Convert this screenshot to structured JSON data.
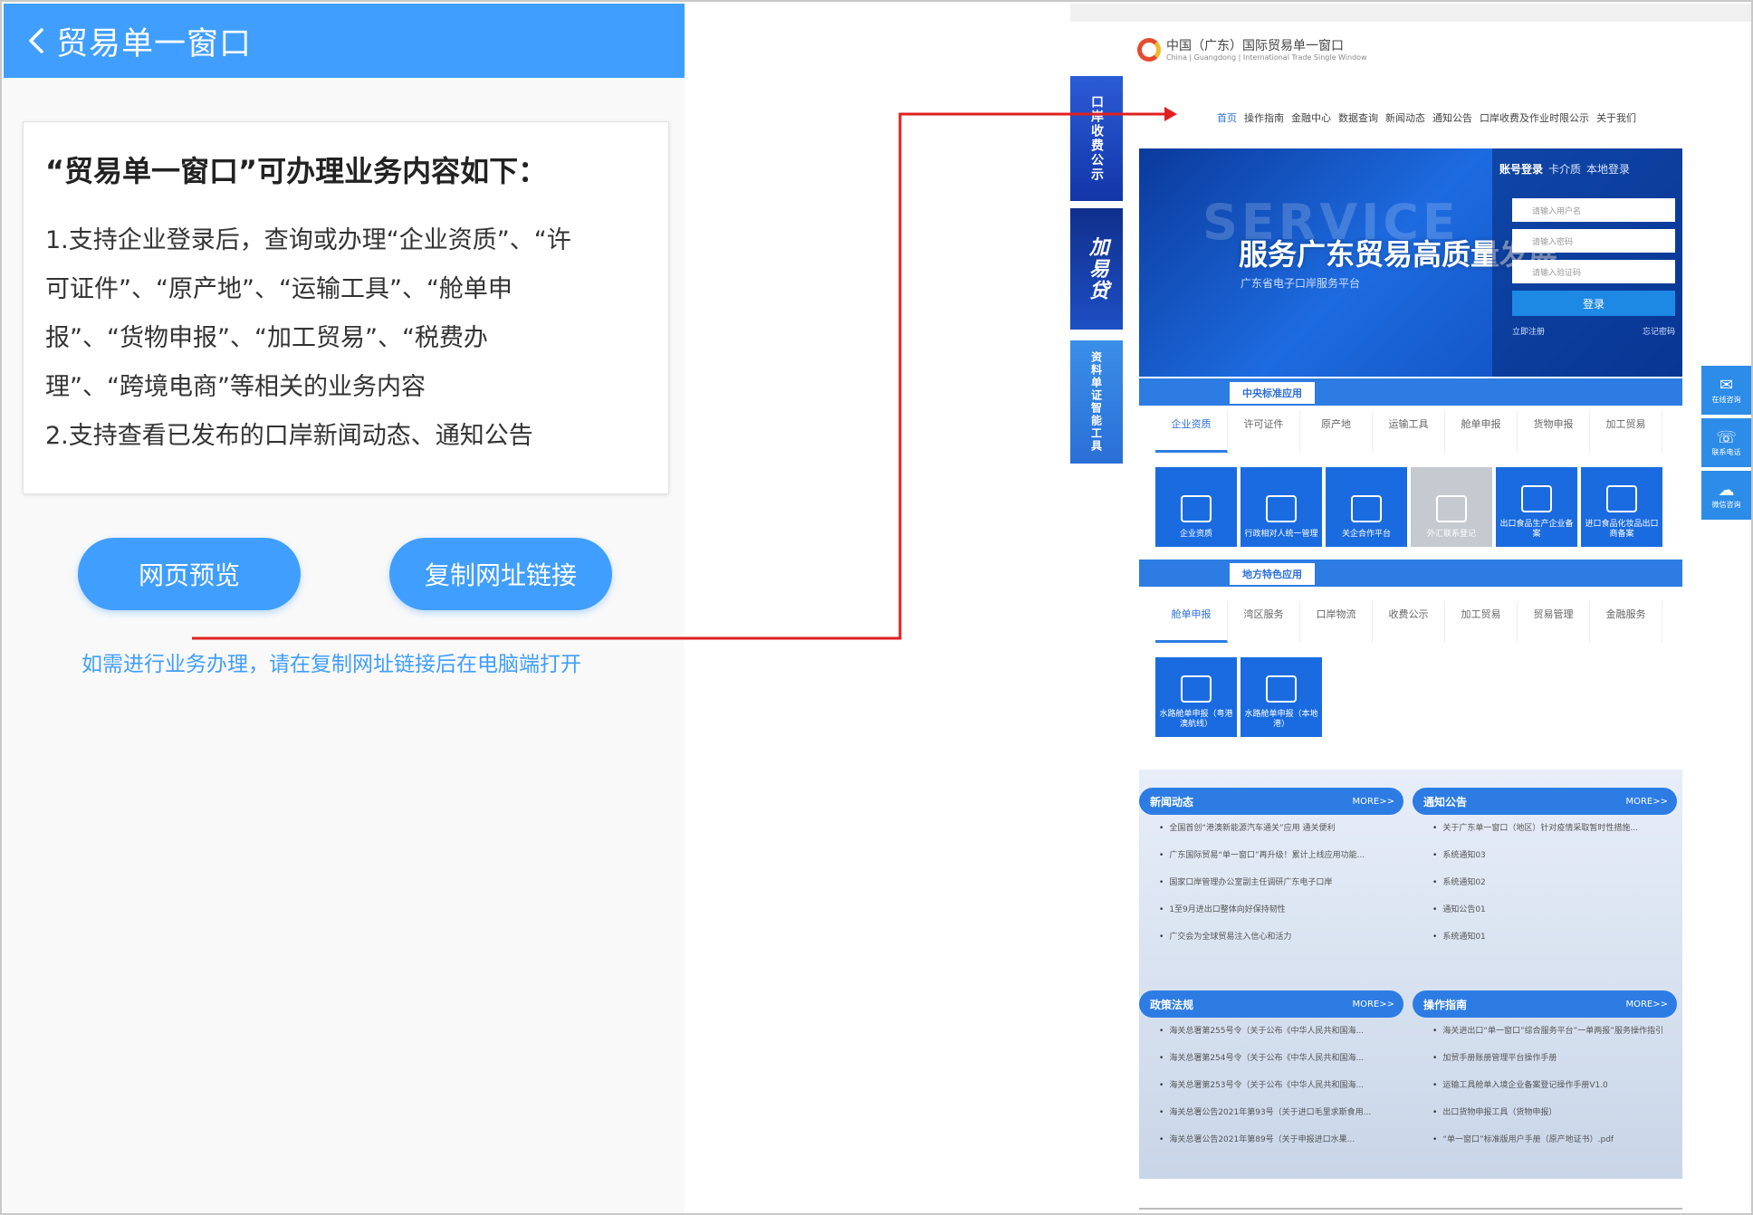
{
  "mobile": {
    "header_title": "贸易单一窗口",
    "card_title": "“贸易单一窗口”可办理业务内容如下：",
    "lines": [
      "1.支持企业登录后，查询或办理“企业资质”、“许",
      "可证件”、“原产地”、“运输工具”、“舱单申",
      "报”、“货物申报”、“加工贸易”、“税费办",
      "理”、“跨境电商”等相关的业务内容",
      "2.支持查看已发布的口岸新闻动态、通知公告"
    ],
    "btn_preview": "网页预览",
    "btn_copy": "复制网址链接",
    "hint": "如需进行业务办理，请在复制网址链接后在电脑端打开",
    "accent": "#409eff"
  },
  "connector_color": "#e02020",
  "web": {
    "logo_text": "中国（广东）国际贸易单一窗口",
    "logo_sub": "China | Guangdong | International Trade Single Window",
    "nav": [
      "首页",
      "操作指南",
      "金融中心",
      "数据查询",
      "新闻动态",
      "通知公告",
      "口岸收费及作业时限公示",
      "关于我们"
    ],
    "side1": "口岸收费公示",
    "side2": "加易贷",
    "side3": "资料单证智能工具",
    "banner_bg": "SERVICE",
    "banner_title": "服务广东贸易高质量发展",
    "banner_sub": "广东省电子口岸服务平台",
    "login_tabs": [
      "账号登录",
      "卡介质",
      "本地登录"
    ],
    "login_fields": [
      "请输入用户名",
      "请输入密码",
      "请输入验证码"
    ],
    "login_btn": "登录",
    "login_links": [
      "立即注册",
      "忘记密码"
    ],
    "sec1_label": "中央标准应用",
    "tabs1": [
      "企业资质",
      "许可证件",
      "原产地",
      "运输工具",
      "舱单申报",
      "货物申报",
      "加工贸易"
    ],
    "tiles1": [
      "企业资质",
      "行政相对人统一管理",
      "关企合作平台",
      "外汇联系登记",
      "出口食品生产企业备案",
      "进口食品化妆品出口商备案"
    ],
    "sec2_label": "地方特色应用",
    "tabs2": [
      "舱单申报",
      "湾区服务",
      "口岸物流",
      "收费公示",
      "加工贸易",
      "贸易管理",
      "金融服务"
    ],
    "tiles2": [
      "水路舱单申报（粤港澳航线）",
      "水路舱单申报（本地港）"
    ],
    "news": {
      "title": "新闻动态",
      "more": "MORE>>",
      "items": [
        "全国首创“港澳新能源汽车通关”应用 通关便利",
        "广东国际贸易“单一窗口”再升级！累计上线应用功能...",
        "国家口岸管理办公室副主任调研广东电子口岸",
        "1至9月进出口整体向好保持韧性",
        "广交会为全球贸易注入信心和活力"
      ]
    },
    "notice": {
      "title": "通知公告",
      "more": "MORE>>",
      "items": [
        "关于广东单一窗口（地区）针对疫情采取暂时性措施...",
        "系统通知03",
        "系统通知02",
        "通知公告01",
        "系统通知01"
      ]
    },
    "policy": {
      "title": "政策法规",
      "more": "MORE>>",
      "items": [
        "海关总署第255号令（关于公布《中华人民共和国海...",
        "海关总署第254号令（关于公布《中华人民共和国海...",
        "海关总署第253号令（关于公布《中华人民共和国海...",
        "海关总署公告2021年第93号（关于进口毛里求斯食用...",
        "海关总署公告2021年第89号（关于申报进口水果..."
      ]
    },
    "guide": {
      "title": "操作指南",
      "more": "MORE>>",
      "items": [
        "海关进出口“单一窗口”综合服务平台”一单两报”服务操作指引",
        "加贸手册账册管理平台操作手册",
        "运输工具舱单入境企业备案登记操作手册V1.0",
        "出口货物申报工具（货物申报）",
        "“单一窗口”标准版用户手册（原产地证书）.pdf"
      ]
    },
    "float": [
      "在线咨询",
      "联系电话",
      "微信咨询"
    ]
  }
}
